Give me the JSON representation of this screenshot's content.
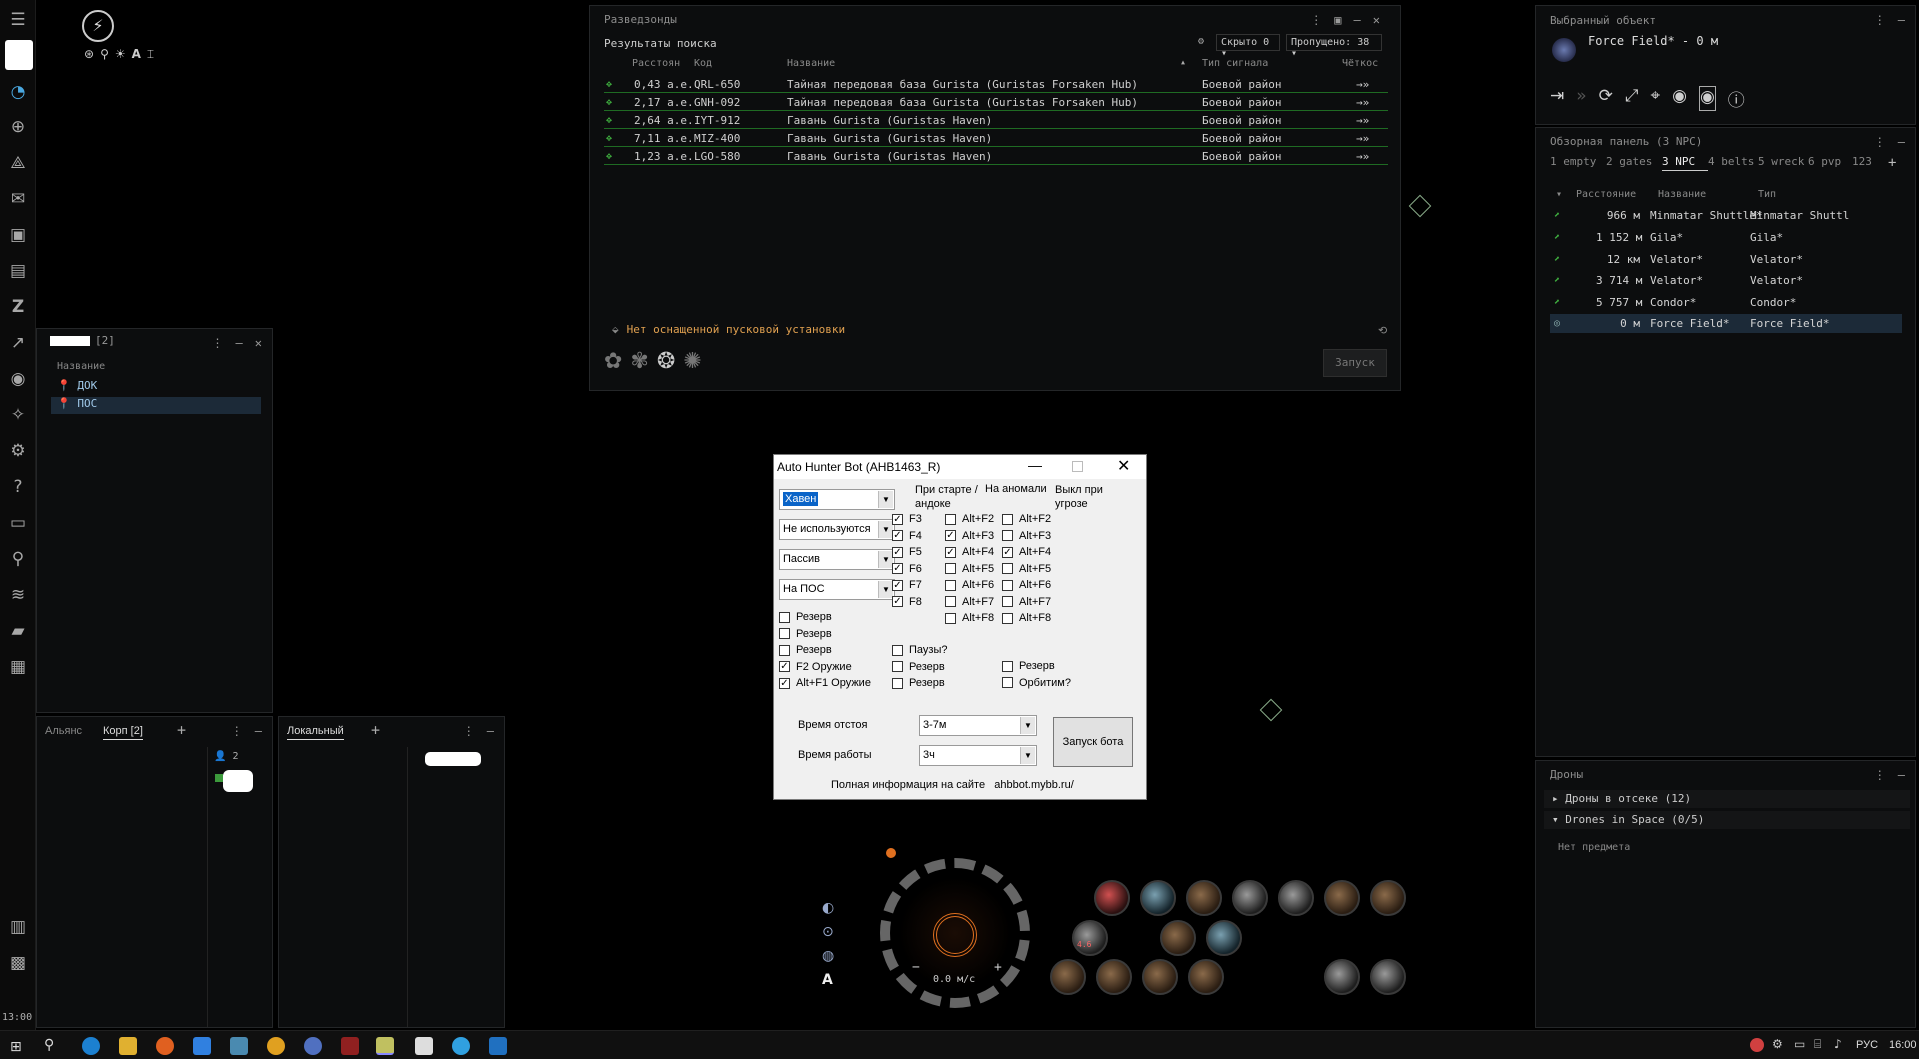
{
  "sidebar": {
    "clock": "13:00",
    "icons": [
      "menu-icon",
      "character-portrait",
      "loading-icon",
      "map-icon",
      "fitting-icon",
      "mail-icon",
      "inventory-icon",
      "assets-icon",
      "z-icon",
      "market-icon",
      "wallet-icon",
      "agency-icon",
      "industry-icon",
      "help-icon",
      "chat-icon",
      "location-icon",
      "layers-icon",
      "folder-icon",
      "notes-icon",
      "calendar-icon",
      "save-icon"
    ]
  },
  "top_left_tools": {
    "letter": "A"
  },
  "probe_scanner": {
    "title": "Разведзонды",
    "results_label": "Результаты поиска",
    "filter_hidden": "Скрыто 0",
    "filter_skipped": "Пропущено: 38",
    "columns": [
      "Расстоян",
      "Код",
      "Название",
      "Тип сигнала",
      "Чёткос"
    ],
    "rows": [
      {
        "distance": "0,43 а.е.",
        "code": "QRL-650",
        "name": "Тайная передовая база Gurista (Guristas Forsaken Hub)",
        "type": "Боевой район"
      },
      {
        "distance": "2,17 а.е.",
        "code": "GNH-092",
        "name": "Тайная передовая база Gurista (Guristas Forsaken Hub)",
        "type": "Боевой район"
      },
      {
        "distance": "2,64 а.е.",
        "code": "IYT-912",
        "name": "Гавань Gurista (Guristas Haven)",
        "type": "Боевой район"
      },
      {
        "distance": "7,11 а.е.",
        "code": "MIZ-400",
        "name": "Гавань Gurista (Guristas Haven)",
        "type": "Боевой район"
      },
      {
        "distance": "1,23 а.е.",
        "code": "LGO-580",
        "name": "Гавань Gurista (Guristas Haven)",
        "type": "Боевой район"
      }
    ],
    "warning": "Нет оснащенной пусковой установки",
    "launch_button": "Запуск"
  },
  "locations": {
    "title_count": "[2]",
    "column": "Название",
    "items": [
      "ДОК",
      "ПОС"
    ]
  },
  "chat": {
    "tabs": [
      "Альянс",
      "Корп [2]"
    ],
    "member_count": "2",
    "local_tab": "Локальный"
  },
  "selected_item": {
    "title": "Выбранный объект",
    "name": "Force Field* - 0 м"
  },
  "overview": {
    "title": "Обзорная панель (3 NPC)",
    "tabs": [
      "1 empty",
      "2 gates",
      "3 NPC",
      "4 belts",
      "5 wreck",
      "6 pvp",
      "123"
    ],
    "active_tab": 2,
    "columns": [
      "Расстояние",
      "Название",
      "Тип"
    ],
    "rows": [
      {
        "distance": "966 м",
        "name": "Minmatar Shuttle*",
        "type": "Minmatar Shuttl"
      },
      {
        "distance": "1 152 м",
        "name": "Gila*",
        "type": "Gila*"
      },
      {
        "distance": "12 км",
        "name": "Velator*",
        "type": "Velator*"
      },
      {
        "distance": "3 714 м",
        "name": "Velator*",
        "type": "Velator*"
      },
      {
        "distance": "5 757 м",
        "name": "Condor*",
        "type": "Condor*"
      },
      {
        "distance": "0 м",
        "name": "Force Field*",
        "type": "Force Field*"
      }
    ]
  },
  "drones": {
    "title": "Дроны",
    "bay": "Дроны в отсеке (12)",
    "space": "Drones in Space (0/5)",
    "empty": "Нет предмета"
  },
  "bot": {
    "title": "Auto Hunter Bot (AHB1463_R)",
    "selects": [
      "Хавен",
      "Не используются",
      "Пассив",
      "На ПОС"
    ],
    "col_headers": [
      "При старте / андоке",
      "На аномали",
      "Выкл при угрозе"
    ],
    "left_checks": [
      {
        "label": "Резерв",
        "checked": false
      },
      {
        "label": "Резерв",
        "checked": false
      },
      {
        "label": "Резерв",
        "checked": false
      },
      {
        "label": "F2 Оружие",
        "checked": true
      },
      {
        "label": "Alt+F1 Оружие",
        "checked": true
      }
    ],
    "start_checks": [
      {
        "label": "F3",
        "checked": true
      },
      {
        "label": "F4",
        "checked": true
      },
      {
        "label": "F5",
        "checked": true
      },
      {
        "label": "F6",
        "checked": true
      },
      {
        "label": "F7",
        "checked": true
      },
      {
        "label": "F8",
        "checked": true
      }
    ],
    "start_extra": [
      {
        "label": "Паузы?",
        "checked": false
      },
      {
        "label": "Резерв",
        "checked": false
      },
      {
        "label": "Резерв",
        "checked": false
      }
    ],
    "anomaly_checks": [
      {
        "label": "Alt+F2",
        "checked": false
      },
      {
        "label": "Alt+F3",
        "checked": true
      },
      {
        "label": "Alt+F4",
        "checked": true
      },
      {
        "label": "Alt+F5",
        "checked": false
      },
      {
        "label": "Alt+F6",
        "checked": false
      },
      {
        "label": "Alt+F7",
        "checked": false
      },
      {
        "label": "Alt+F8",
        "checked": false
      }
    ],
    "threat_checks": [
      {
        "label": "Alt+F2",
        "checked": false
      },
      {
        "label": "Alt+F3",
        "checked": false
      },
      {
        "label": "Alt+F4",
        "checked": true
      },
      {
        "label": "Alt+F5",
        "checked": false
      },
      {
        "label": "Alt+F6",
        "checked": false
      },
      {
        "label": "Alt+F7",
        "checked": false
      },
      {
        "label": "Alt+F8",
        "checked": false
      }
    ],
    "threat_extra": [
      {
        "label": "Резерв",
        "checked": false
      },
      {
        "label": "Орбитим?",
        "checked": false
      }
    ],
    "idle_label": "Время отстоя",
    "idle_value": "3-7м",
    "work_label": "Время работы",
    "work_value": "3ч",
    "start_button": "Запуск бота",
    "footer": "Полная информация на сайте   ahbbot.mybb.ru/"
  },
  "hud": {
    "speed": "0.0 м/с",
    "module_label": "4.6"
  },
  "taskbar": {
    "lang": "РУС",
    "time": "16:00"
  }
}
